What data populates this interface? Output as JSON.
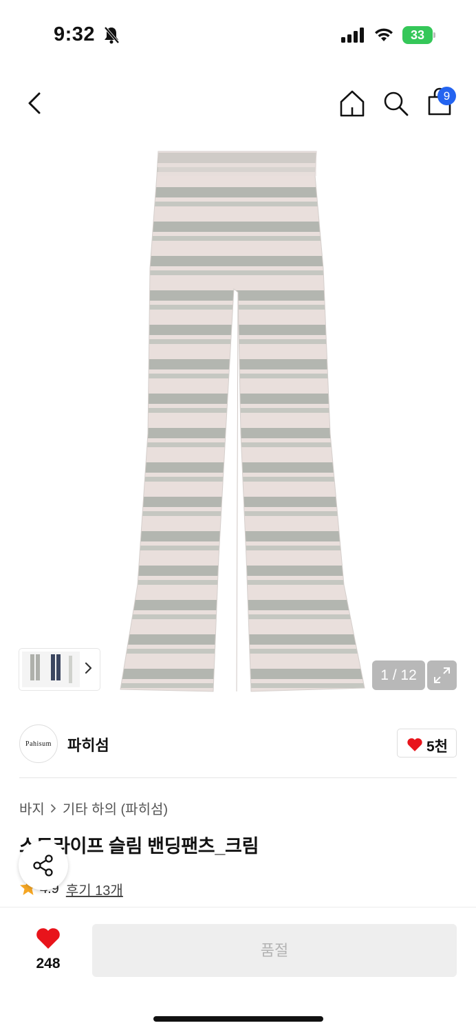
{
  "status_bar": {
    "time": "9:32",
    "battery": "33",
    "icons": [
      "bell-slash-icon",
      "signal-icon",
      "wifi-icon",
      "battery-icon"
    ]
  },
  "header": {
    "icons": [
      "back-icon",
      "home-icon",
      "search-icon",
      "bag-icon"
    ],
    "cart_count": "9"
  },
  "gallery": {
    "counter": "1 / 12",
    "icons": [
      "chevron-right-icon",
      "expand-icon"
    ]
  },
  "brand": {
    "logo_text": "Pahisum",
    "name": "파히섬",
    "like_count": "5천"
  },
  "breadcrumb": {
    "items": [
      "바지",
      "기타 하의 (파히섬)"
    ]
  },
  "product": {
    "title": "스트라이프 슬림 밴딩팬츠_크림",
    "rating": "4.9",
    "reviews": "후기 13개"
  },
  "bottom_bar": {
    "like_count": "248",
    "cta_label": "품절"
  },
  "colors": {
    "accent_badge": "#2464f0",
    "heart": "#e8141b",
    "star": "#f5a623",
    "battery": "#35c759"
  }
}
